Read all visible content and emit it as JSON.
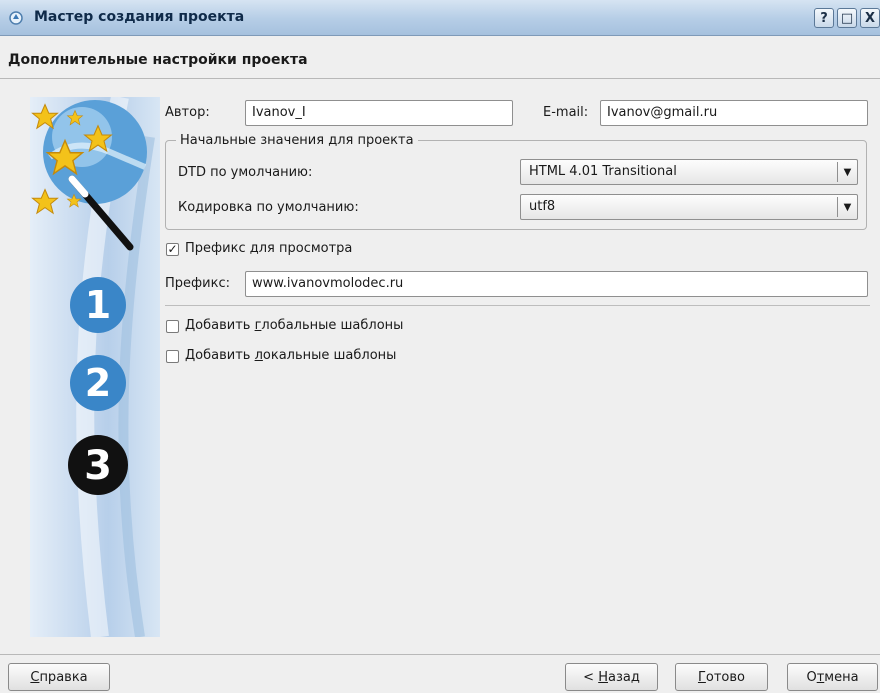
{
  "window": {
    "title": "Мастер создания проекта",
    "buttons": {
      "help": "?",
      "maximize": "□",
      "close": "X"
    }
  },
  "page": {
    "header": "Дополнительные настройки проекта"
  },
  "form": {
    "author_label": "Автор:",
    "author_value": "Ivanov_I",
    "email_label": "E-mail:",
    "email_value": "Ivanov@gmail.ru",
    "group_title": "Начальные значения для проекта",
    "dtd_label": "DTD по умолчанию:",
    "dtd_value": "HTML 4.01 Transitional",
    "encoding_label": "Кодировка по умолчанию:",
    "encoding_value": "utf8",
    "preview_prefix": {
      "label_pre": "Префикс ",
      "label_acc": "д",
      "label_post": "ля просмотра",
      "checked": true
    },
    "prefix_label": "Префикс:",
    "prefix_value": "www.ivanovmolodec.ru",
    "global_templates": {
      "label_pre": "Добавить ",
      "label_acc": "г",
      "label_post": "лобальные шаблоны",
      "checked": false
    },
    "local_templates": {
      "label_pre": "Добавить ",
      "label_acc": "л",
      "label_post": "окальные шаблоны",
      "checked": false
    }
  },
  "steps": [
    "1",
    "2",
    "3"
  ],
  "footer": {
    "help": {
      "acc": "С",
      "rest": "правка"
    },
    "back": {
      "pre": "< ",
      "acc": "Н",
      "rest": "азад"
    },
    "finish": {
      "acc": "Г",
      "rest": "отово"
    },
    "cancel": {
      "pre": "О",
      "acc": "т",
      "rest": "мена"
    }
  },
  "colors": {
    "titlebar": "#b5cde6",
    "panel": "#b7cfea",
    "star": "#f3c21a",
    "step_active": "#111111",
    "step_inactive": "#3a86c8"
  }
}
